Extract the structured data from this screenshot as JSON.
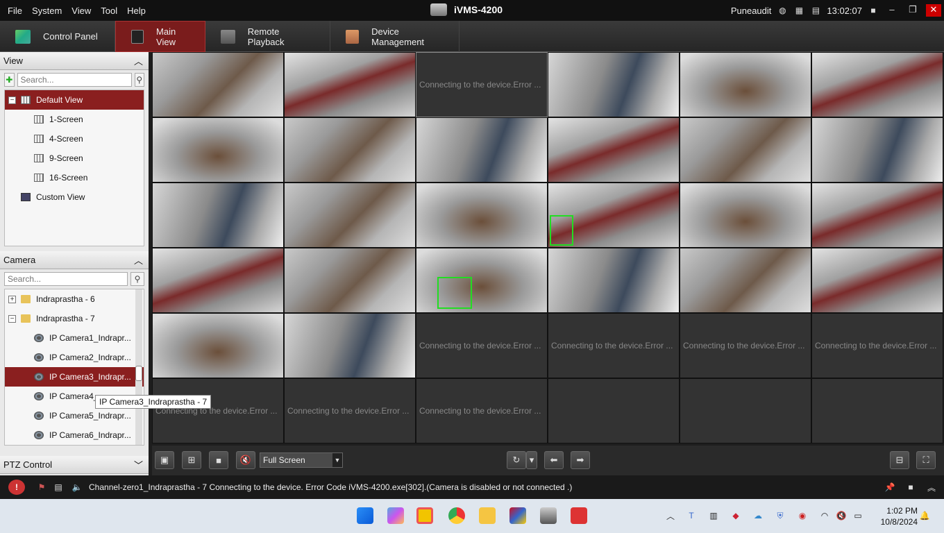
{
  "menubar": {
    "items": [
      "File",
      "System",
      "View",
      "Tool",
      "Help"
    ],
    "app_title": "iVMS-4200",
    "user": "Puneaudit",
    "time": "13:02:07"
  },
  "tabs": [
    {
      "label": "Control Panel",
      "icon": "control-panel-icon"
    },
    {
      "label": "Main View",
      "icon": "main-view-icon"
    },
    {
      "label": "Remote Playback",
      "icon": "remote-playback-icon"
    },
    {
      "label": "Device Management",
      "icon": "device-management-icon"
    }
  ],
  "view_panel": {
    "title": "View",
    "search_placeholder": "Search...",
    "items": [
      "Default View",
      "1-Screen",
      "4-Screen",
      "9-Screen",
      "16-Screen",
      "Custom View"
    ]
  },
  "camera_panel": {
    "title": "Camera",
    "search_placeholder": "Search...",
    "items": [
      "Indraprastha - 6",
      "Indraprastha - 7",
      "IP Camera1_Indrapr...",
      "IP Camera2_Indrapr...",
      "IP Camera3_Indrapr...",
      "IP Camera4_",
      "IP Camera5_Indrapr...",
      "IP Camera6_Indrapr..."
    ],
    "tooltip": "IP Camera3_Indraprastha - 7"
  },
  "ptz": {
    "title": "PTZ Control"
  },
  "grid": {
    "error_text": "Connecting to the device.Error ..."
  },
  "toolbar": {
    "mode": "Full Screen"
  },
  "status": {
    "message": "Channel-zero1_Indraprastha - 7 Connecting to the device. Error Code iVMS-4200.exe[302].(Camera is disabled or not connected .)"
  },
  "taskbar": {
    "time": "1:02 PM",
    "date": "10/8/2024"
  },
  "colors": {
    "accent": "#8a1f1f",
    "detection_box": "#22dd22"
  }
}
